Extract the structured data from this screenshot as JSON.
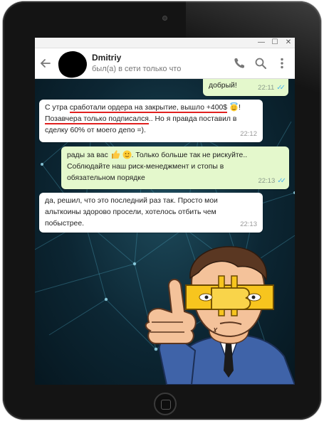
{
  "window": {
    "minimize_label": "—",
    "maximize_label": "☐",
    "close_label": "✕"
  },
  "header": {
    "contact_name": "Dmitriy",
    "status": "был(а) в сети только что",
    "icons": [
      "back-arrow-icon",
      "phone-icon",
      "search-icon",
      "more-vert-icon"
    ]
  },
  "messages": [
    {
      "direction": "out",
      "text": "добрый!",
      "time": "22:11",
      "read": true
    },
    {
      "direction": "in",
      "parts": {
        "p1": "С утра ",
        "p2": "сработали ордера на закрытие, вышло +400$",
        "p3": " ",
        "p4": "!",
        "p5": "Позавчера только подписался",
        "p6": ".. Но я правда поставил в",
        "p7": "сделку 60% от моего депо  =)."
      },
      "emoji": "smiling-face-with-halo",
      "time": "22:12"
    },
    {
      "direction": "out",
      "parts": {
        "p1": "рады за вас ",
        "p2": " ",
        "p3": ". Только больше так не рискуйте..",
        "p4": "Соблюдайте наш риск-менеджмент и стопы в",
        "p5": "обязательном порядке"
      },
      "emoji": [
        "thumbs-up",
        "slightly-smiling-face"
      ],
      "time": "22:13",
      "read": true
    },
    {
      "direction": "in",
      "lines": [
        "да, решил, что это последний раз так. Просто мои",
        "альткоины здорово просели, хотелось отбить чем",
        "побыстрее."
      ],
      "time": "22:13"
    }
  ],
  "sticker": "bitcoin-mask-businessman-thumbs-up",
  "colors": {
    "outgoing_bubble": "#e4f8cc",
    "incoming_bubble": "#ffffff",
    "read_ticks": "#4fb6ec",
    "underline": "#e0201f"
  }
}
